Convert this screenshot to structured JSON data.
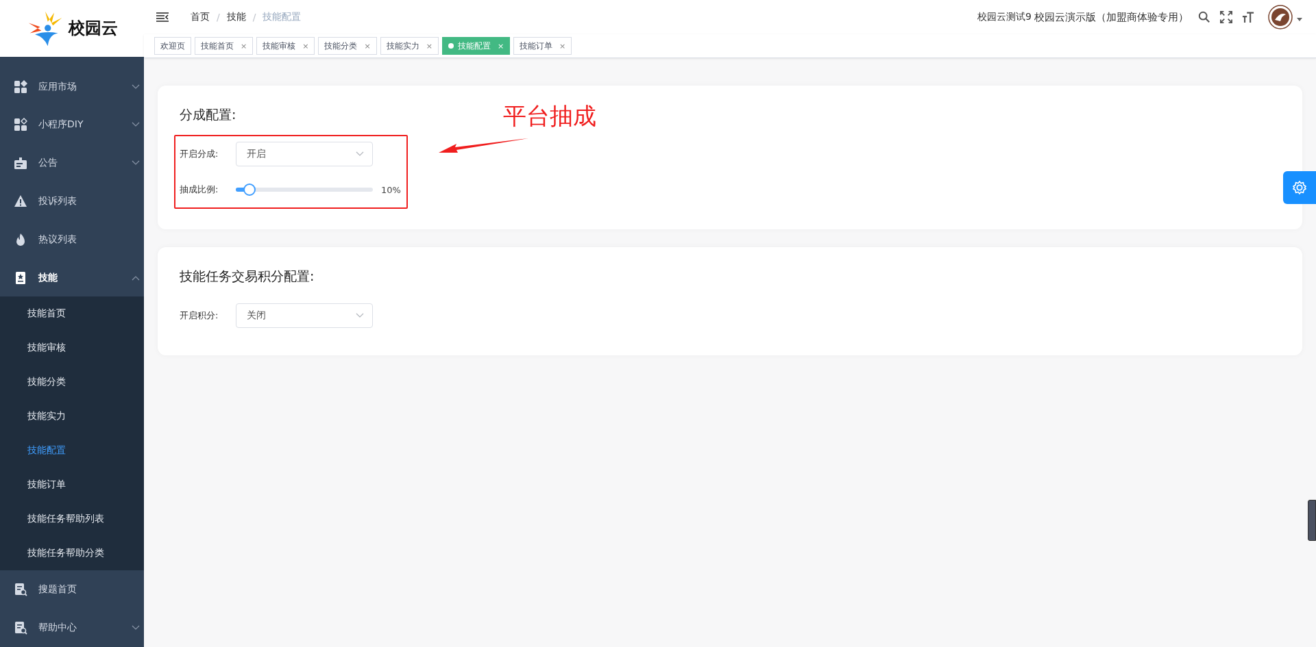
{
  "logo": {
    "name": "校园云"
  },
  "breadcrumb": [
    {
      "label": "首页",
      "current": false
    },
    {
      "label": "技能",
      "current": false
    },
    {
      "label": "技能配置",
      "current": true
    }
  ],
  "breadcrumb_separator": "/",
  "header": {
    "account": "校园云测试9",
    "org": "校园云演示版（加盟商体验专用）"
  },
  "tabs": [
    {
      "label": "欢迎页",
      "selected": false
    },
    {
      "label": "技能首页",
      "close": "×",
      "selected": false
    },
    {
      "label": "技能审核",
      "close": "×",
      "selected": false
    },
    {
      "label": "技能分类",
      "close": "×",
      "selected": false
    },
    {
      "label": "技能实力",
      "close": "×",
      "selected": false
    },
    {
      "label": "技能配置",
      "close": "×",
      "selected": true
    },
    {
      "label": "技能订单",
      "close": "×",
      "selected": false
    }
  ],
  "sidebar": {
    "items": [
      {
        "label": "应用市场",
        "kind": "submenu",
        "expanded": false
      },
      {
        "label": "小程序DIY",
        "kind": "submenu",
        "expanded": false
      },
      {
        "label": "公告",
        "kind": "submenu",
        "expanded": false
      },
      {
        "label": "投诉列表",
        "kind": "link"
      },
      {
        "label": "热议列表",
        "kind": "link"
      },
      {
        "label": "技能",
        "kind": "submenu",
        "expanded": true,
        "children": [
          {
            "label": "技能首页",
            "selected": false
          },
          {
            "label": "技能审核",
            "selected": false
          },
          {
            "label": "技能分类",
            "selected": false
          },
          {
            "label": "技能实力",
            "selected": false
          },
          {
            "label": "技能配置",
            "selected": true
          },
          {
            "label": "技能订单",
            "selected": false
          },
          {
            "label": "技能任务帮助列表",
            "selected": false
          },
          {
            "label": "技能任务帮助分类",
            "selected": false
          }
        ]
      },
      {
        "label": "搜题首页",
        "kind": "link"
      },
      {
        "label": "帮助中心",
        "kind": "submenu",
        "expanded": false
      }
    ]
  },
  "cards": [
    {
      "title": "分成配置:",
      "highlighted": true,
      "rows": [
        {
          "kind": "select",
          "label": "开启分成:",
          "value": "开启"
        },
        {
          "kind": "slider",
          "label": "抽成比例:",
          "level": 0.1,
          "reading": "10%"
        }
      ]
    },
    {
      "title": "技能任务交易积分配置:",
      "highlighted": false,
      "rows": [
        {
          "kind": "select",
          "label": "开启积分:",
          "value": "关闭"
        }
      ]
    }
  ],
  "annotation": {
    "text": "平台抽成"
  }
}
